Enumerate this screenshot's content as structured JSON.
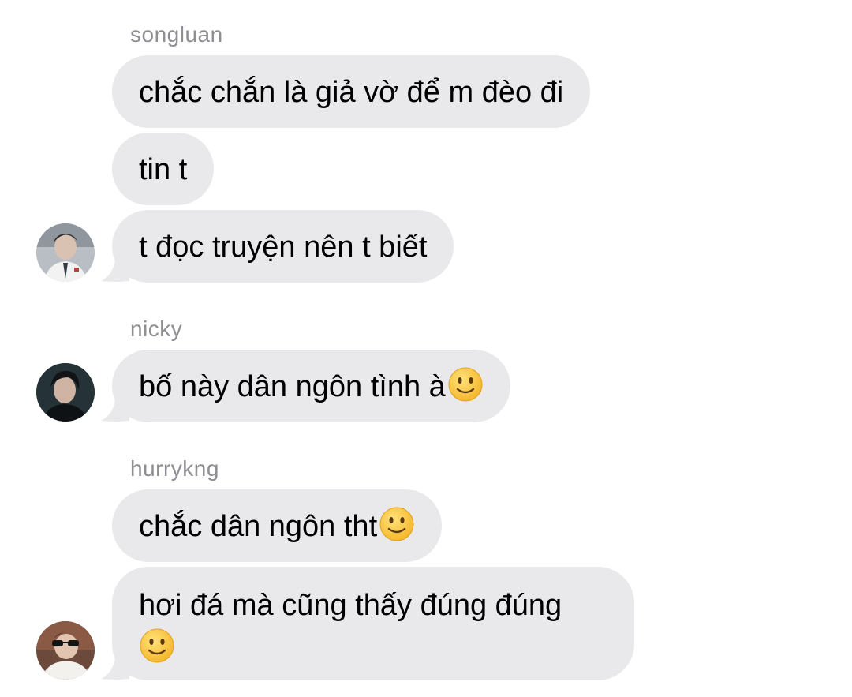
{
  "groups": [
    {
      "sender": "songluan",
      "messages": [
        "chắc chắn là giả vờ để m đèo đi",
        "tin t",
        "t đọc truyện nên t biết"
      ],
      "avatar_icon": "user-avatar-icon"
    },
    {
      "sender": "nicky",
      "messages": [
        "bố này dân ngôn tình à"
      ],
      "avatar_icon": "user-avatar-icon"
    },
    {
      "sender": "hurrykng",
      "messages": [
        "chắc dân ngôn tht",
        "hơi đá mà cũng thấy đúng đúng"
      ],
      "avatar_icon": "user-avatar-icon"
    }
  ],
  "emoji": "slightly-smiling-face-icon",
  "colors": {
    "bubble": "#e9e9eb",
    "sender_text": "#8e8e93",
    "message_text": "#000000",
    "background": "#ffffff"
  }
}
